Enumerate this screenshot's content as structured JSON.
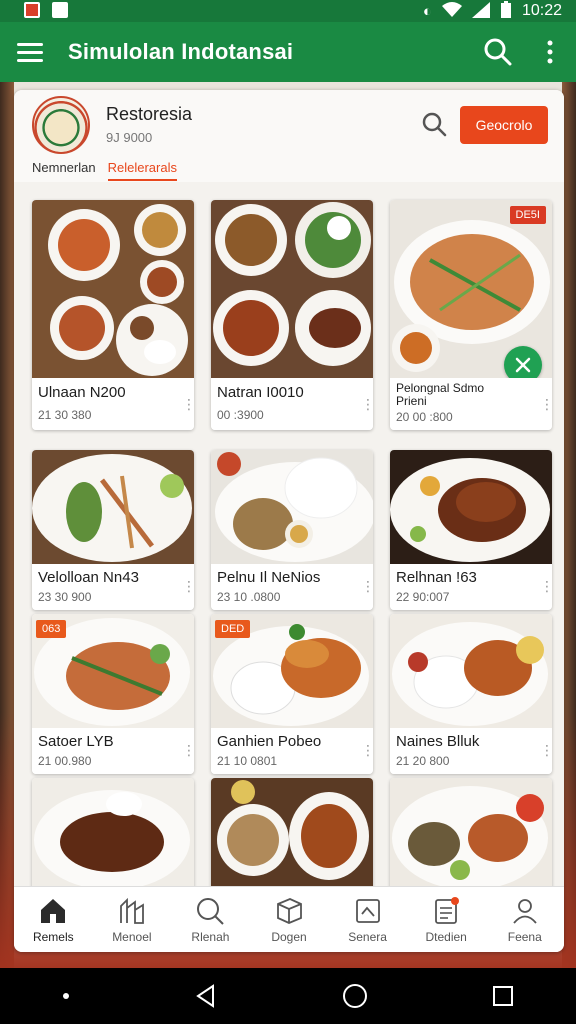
{
  "status_bar": {
    "time": "10:22"
  },
  "app_bar": {
    "title": "Simulolan Indotansai"
  },
  "restaurant": {
    "name": "Restoresia",
    "subtitle": "9J 9000",
    "action_button": "Geocrolo",
    "tabs": [
      {
        "label": "Nemnerlan",
        "active": false
      },
      {
        "label": "Relelerarals",
        "active": true
      }
    ]
  },
  "menu_items": [
    {
      "name": "Ulnaan N200",
      "price": "21 30 380"
    },
    {
      "name": "Natran I0010",
      "price": "00 :3900"
    },
    {
      "name": "Pelongnal Sdmo Prieni",
      "price": "20 00 :800",
      "badge": "DE5I"
    },
    {
      "name": "Velolloan Nn43",
      "price": "23 30 900"
    },
    {
      "name": "Pelnu Il NeNios",
      "price": "23 10 .0800"
    },
    {
      "name": "Relhnan !63",
      "price": "22 90:007"
    },
    {
      "name": "Satoer LYB",
      "price": "21 00.980",
      "badge": "063"
    },
    {
      "name": "Ganhien Pobeo",
      "price": "21 10 0801",
      "badge": "DED"
    },
    {
      "name": "Naines Blluk",
      "price": "21 20 800"
    },
    {
      "name": "",
      "price": ""
    },
    {
      "name": "",
      "price": ""
    },
    {
      "name": "",
      "price": ""
    }
  ],
  "bottom_nav": [
    {
      "label": "Remels",
      "icon": "home-icon",
      "active": true
    },
    {
      "label": "Menoel",
      "icon": "store-icon",
      "active": false
    },
    {
      "label": "Rlenah",
      "icon": "search-icon",
      "active": false
    },
    {
      "label": "Dogen",
      "icon": "box-icon",
      "active": false
    },
    {
      "label": "Senera",
      "icon": "card-icon",
      "active": false
    },
    {
      "label": "Dtedien",
      "icon": "orders-icon",
      "active": false
    },
    {
      "label": "Feena",
      "icon": "profile-icon",
      "active": false
    }
  ],
  "colors": {
    "primary_green": "#1a8a43",
    "status_green": "#17783a",
    "accent_orange": "#e8471c",
    "badge_red": "#d93a23"
  }
}
